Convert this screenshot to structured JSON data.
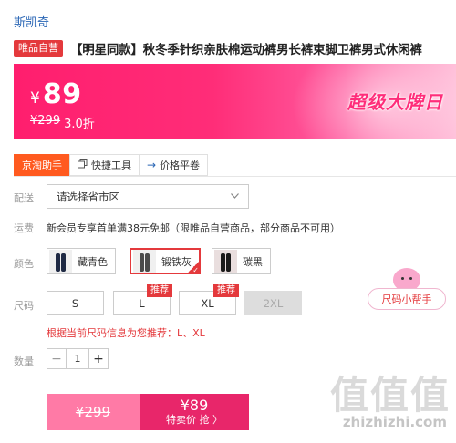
{
  "brand": "斯凯奇",
  "badge": "唯品自营",
  "title": "【明星同款】秋冬季针织亲肤棉运动裤男长裤束脚卫裤男式休闲裤",
  "price": {
    "currency": "¥",
    "current": "89",
    "original": "¥299",
    "discount": "3.0折",
    "promo": "超级大牌日"
  },
  "tabs": [
    {
      "label": "京淘助手",
      "icon": ""
    },
    {
      "label": "快捷工具",
      "icon": "copy-icon"
    },
    {
      "label": "价格平卷",
      "icon": "arrow-right-icon"
    }
  ],
  "delivery": {
    "label": "配送",
    "placeholder": "请选择省市区"
  },
  "freight": {
    "label": "运费",
    "text": "新会员专享首单满38元免邮（限唯品自营商品，部分商品不可用）"
  },
  "color": {
    "label": "颜色",
    "options": [
      {
        "name": "藏青色",
        "selected": false,
        "swatch": "#1f2a44"
      },
      {
        "name": "锻铁灰",
        "selected": true,
        "swatch": "#4a4a4a"
      },
      {
        "name": "碳黑",
        "selected": false,
        "swatch": "#1a1a1a"
      }
    ]
  },
  "size": {
    "label": "尺码",
    "options": [
      {
        "name": "S",
        "recommended": false,
        "disabled": false
      },
      {
        "name": "L",
        "recommended": true,
        "disabled": false
      },
      {
        "name": "XL",
        "recommended": true,
        "disabled": false
      },
      {
        "name": "2XL",
        "recommended": false,
        "disabled": true
      }
    ],
    "recommend_tag": "推荐",
    "helper": "尺码小帮手",
    "hint": "根据当前尺码信息为您推荐：L、XL"
  },
  "quantity": {
    "label": "数量",
    "minus": "−",
    "value": "1",
    "plus": "+"
  },
  "buy": {
    "old_price": "¥299",
    "new_price": "¥89",
    "action": "特卖价 抢 〉"
  },
  "watermark": {
    "logo": "值值值",
    "url": "zhizhizhi.com"
  },
  "colors": {
    "accent": "#e4393c",
    "banner": "#ff2d78",
    "brand_link": "#2a66b5",
    "tab_active": "#ff5a1f"
  }
}
